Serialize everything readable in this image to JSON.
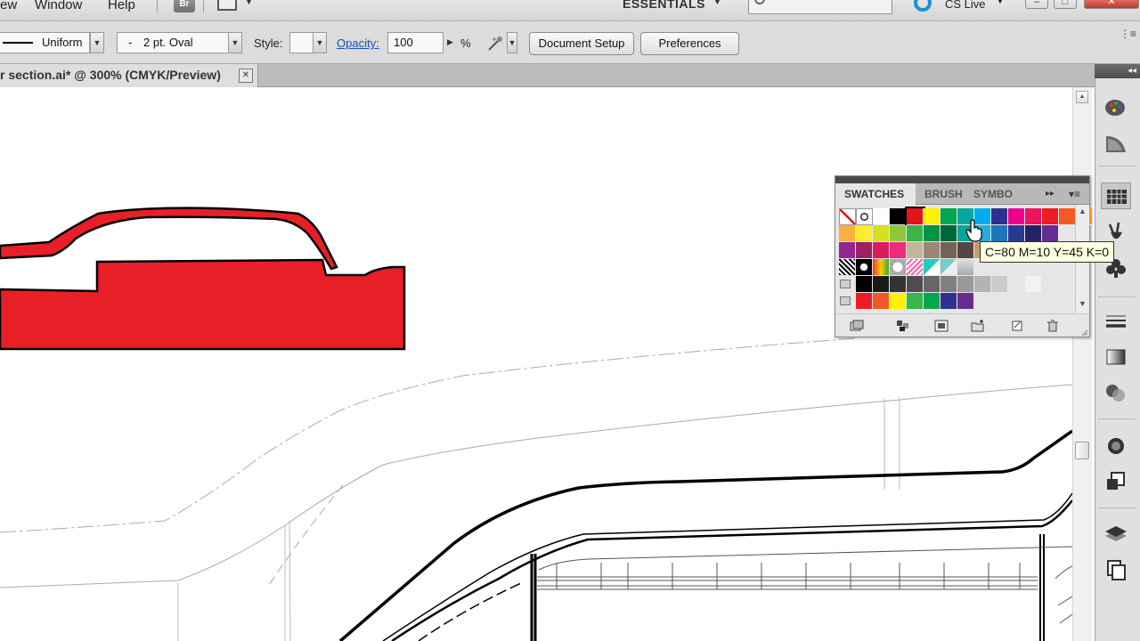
{
  "menubar": {
    "items": [
      "ew",
      "Window",
      "Help"
    ],
    "bridge_label": "Br",
    "workspace": "ESSENTIALS",
    "cs_live": "CS Live",
    "window_buttons": [
      "–",
      "□",
      "✕"
    ]
  },
  "controlbar": {
    "stroke_profile": "Uniform",
    "brush_value": "-",
    "brush_name": "2 pt. Oval",
    "style_label": "Style:",
    "opacity_label": "Opacity:",
    "opacity_value": "100",
    "percent": "%",
    "document_setup": "Document Setup",
    "preferences": "Preferences"
  },
  "document": {
    "tab_label": "r section.ai* @ 300% (CMYK/Preview)",
    "close_glyph": "✕"
  },
  "swatches_panel": {
    "tabs": [
      "SWATCHES",
      "BRUSH",
      "SYMBO"
    ],
    "more_glyph": "▸▸",
    "menu_glyph": "▾≡",
    "rows": [
      [
        "none",
        "registration",
        "#ffffff",
        "#000000",
        "#e3141b",
        "#fff200",
        "#00a651",
        "#00a99d",
        "#00aeef",
        "#2e3192",
        "#ec008c",
        "#ed145b",
        "#ed1c24",
        "#f15a24",
        "#f7941d"
      ],
      [
        "#fbb040",
        "#f9ed32",
        "#d7df23",
        "#8dc63f",
        "#39b54a",
        "#009444",
        "#006838",
        "#00a79d",
        "#27aae1",
        "#1c75bc",
        "#2b3990",
        "#262262",
        "#662d91"
      ],
      [
        "#92278f",
        "#9e1f63",
        "#da1c5c",
        "#ee2a7b",
        "#c2b59b",
        "#998675",
        "#736357",
        "#534741",
        "#c69c6d",
        "#a67c52",
        "#8c6239",
        "#754c24",
        "#603913"
      ],
      [
        "pattern1",
        "pattern2",
        "pattern3",
        "pattern4",
        "pattern5",
        "pattern6",
        "pattern7",
        "pattern8"
      ],
      [
        "#000000",
        "#1a1a1a",
        "#333333",
        "#4d4d4d",
        "#666666",
        "#808080",
        "#999999",
        "#b3b3b3",
        "#cccccc",
        "#e6e6e6",
        "#f2f2f2"
      ],
      [
        "#ed1c24",
        "#f15a24",
        "#fff200",
        "#39b54a",
        "#00a651",
        "#2e3192",
        "#662d91"
      ]
    ],
    "tooltip": "C=80 M=10 Y=45 K=0"
  },
  "colors": {
    "artwork_red": "#e81f27",
    "cs_live_blue": "#1e8fd8",
    "link_blue": "#1a50b4"
  }
}
